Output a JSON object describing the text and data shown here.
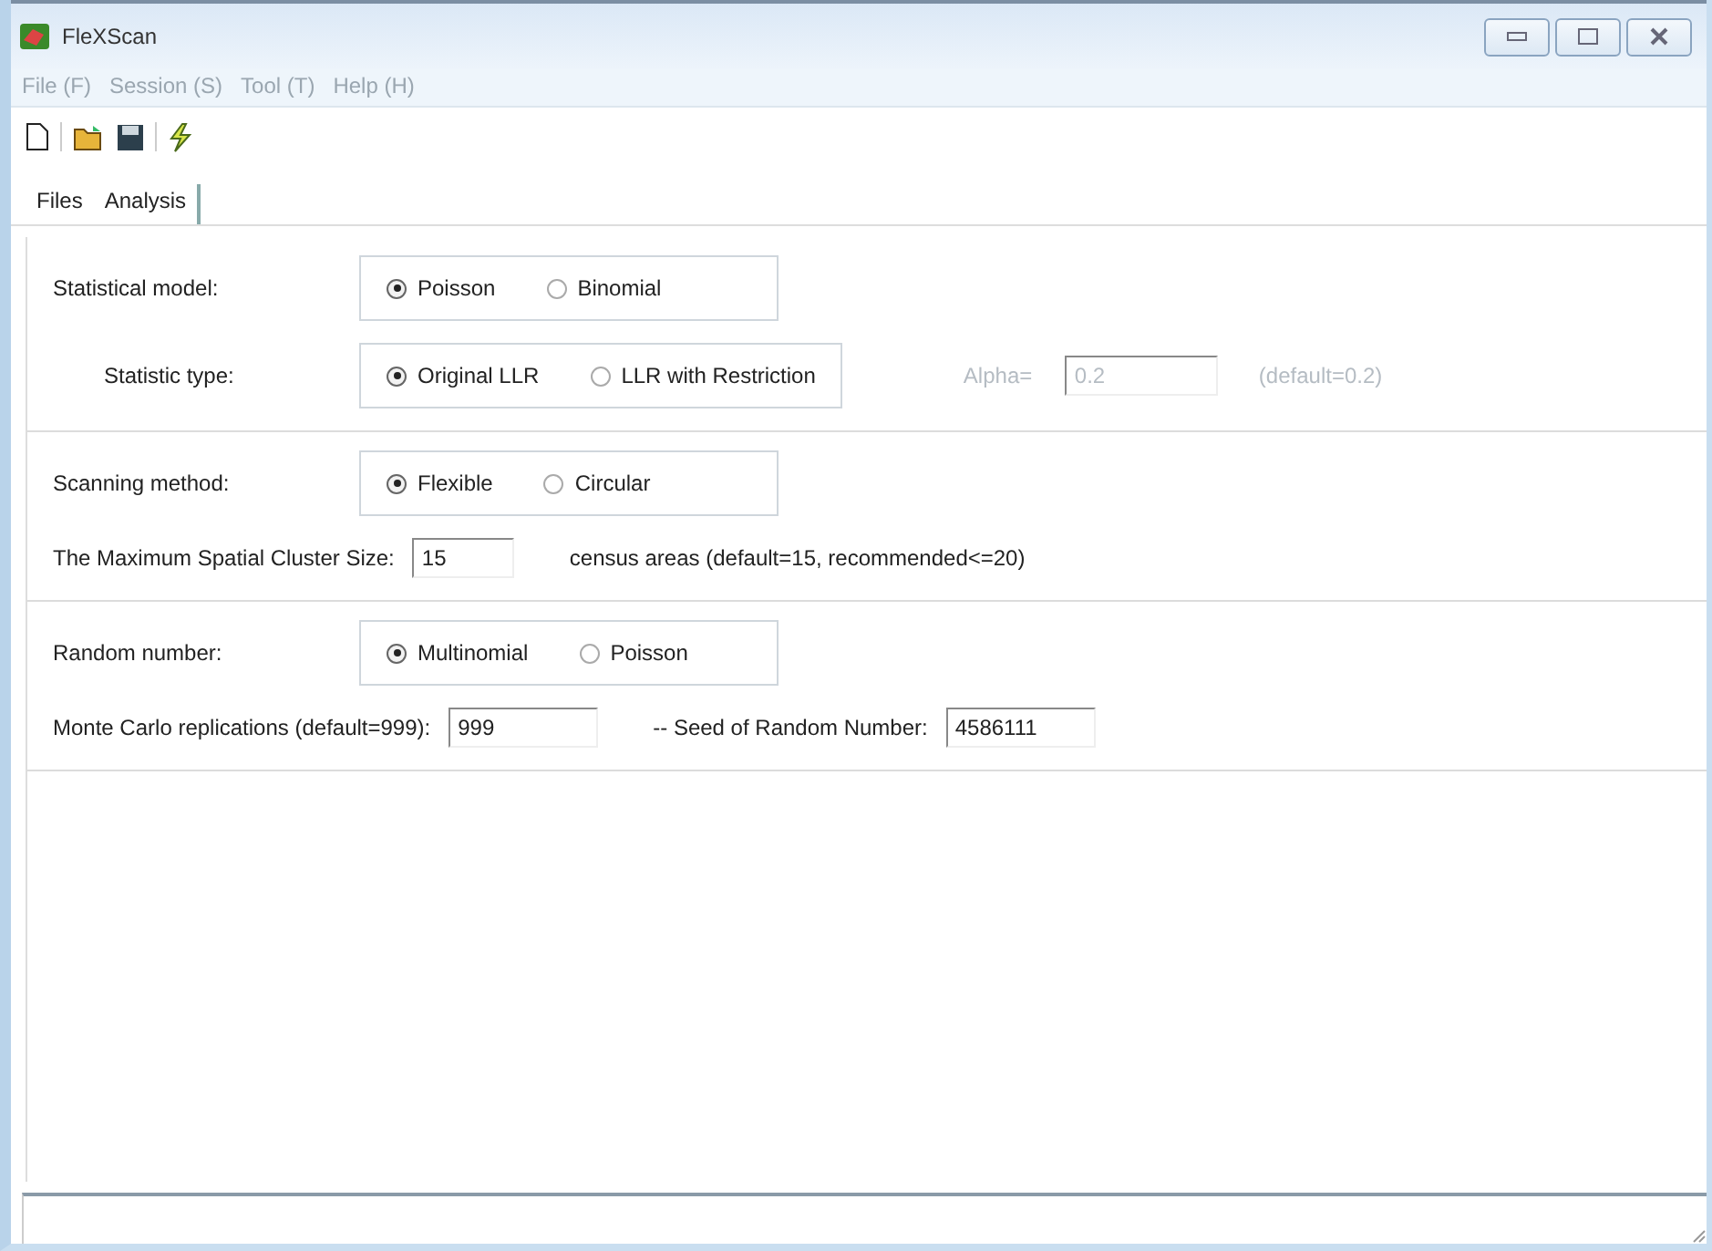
{
  "window": {
    "title": "FleXScan"
  },
  "menu": [
    "File (F)",
    "Session (S)",
    "Tool (T)",
    "Help (H)"
  ],
  "toolbar": [
    {
      "kind": "new"
    },
    {
      "kind": "separator"
    },
    {
      "kind": "open"
    },
    {
      "kind": "save"
    },
    {
      "kind": "separator"
    },
    {
      "kind": "run"
    }
  ],
  "tabs": [
    {
      "label": "Files",
      "selected": false
    },
    {
      "label": "Analysis",
      "selected": true
    }
  ],
  "sections": [
    {
      "rows": [
        {
          "kind": "radio",
          "label": "Statistical model:",
          "options": [
            {
              "label": "Poisson",
              "selected": true
            },
            {
              "label": "Binomial",
              "selected": false
            }
          ]
        },
        {
          "kind": "subradio",
          "label": "Statistic type:",
          "options": [
            {
              "label": "Original LLR",
              "selected": true
            },
            {
              "label": "LLR with Restriction",
              "selected": false
            }
          ],
          "extra": {
            "label": "Alpha=",
            "value": "0.2",
            "note": "(default=0.2)",
            "disabled": true
          }
        }
      ]
    },
    {
      "rows": [
        {
          "kind": "radio",
          "label": "Scanning method:",
          "options": [
            {
              "label": "Flexible",
              "selected": true
            },
            {
              "label": "Circular",
              "selected": false
            }
          ]
        },
        {
          "kind": "fields",
          "items": [
            {
              "kind": "text",
              "text": "The Maximum Spatial Cluster Size:"
            },
            {
              "kind": "input",
              "value": "15"
            },
            {
              "kind": "text",
              "text": "census areas (default=15, recommended<=20)"
            }
          ]
        }
      ]
    },
    {
      "rows": [
        {
          "kind": "radio",
          "label": "Random number:",
          "options": [
            {
              "label": "Multinomial",
              "selected": true
            },
            {
              "label": "Poisson",
              "selected": false
            }
          ]
        },
        {
          "kind": "fields",
          "items": [
            {
              "kind": "text",
              "text": "Monte Carlo replications (default=999):"
            },
            {
              "kind": "input",
              "value": "999"
            },
            {
              "kind": "text",
              "text": "-- Seed of Random Number:"
            },
            {
              "kind": "input",
              "value": "4586111"
            }
          ]
        }
      ]
    }
  ]
}
